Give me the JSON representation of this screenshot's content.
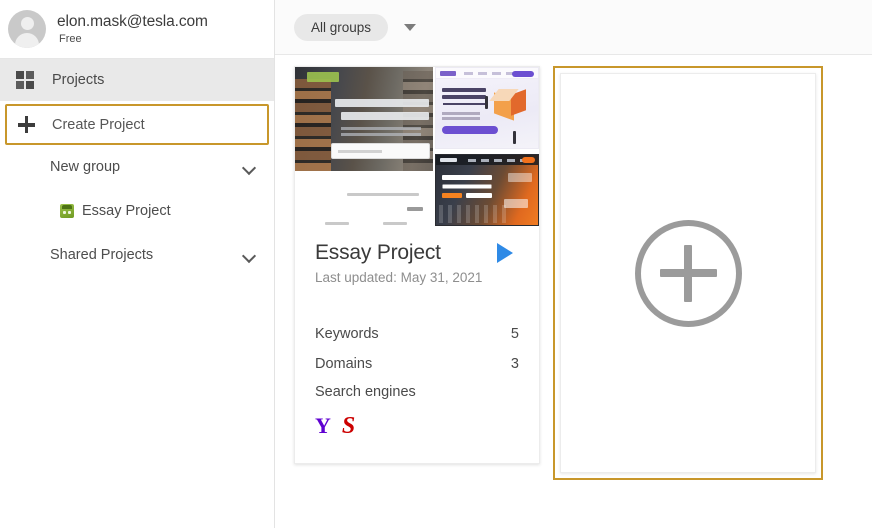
{
  "sidebar": {
    "account": {
      "email": "elon.mask@tesla.com",
      "plan": "Free",
      "avatar_icon": "user-avatar-icon"
    },
    "nav": {
      "projects_label": "Projects",
      "projects_icon": "grid-icon",
      "create_project_label": "Create Project",
      "create_project_icon": "plus-icon"
    },
    "groups": [
      {
        "label": "New group",
        "icon": "chevron-down-icon"
      },
      {
        "label": "Shared Projects",
        "icon": "chevron-down-icon"
      }
    ],
    "projects": [
      {
        "label": "Essay Project",
        "icon": "site-favicon-icon"
      }
    ]
  },
  "topbar": {
    "group_filter_label": "All groups",
    "caret_icon": "caret-down-icon"
  },
  "project_card": {
    "title": "Essay Project",
    "last_updated": "Last updated: May 31, 2021",
    "play_icon": "play-icon",
    "stats": [
      {
        "label": "Keywords",
        "value": "5"
      },
      {
        "label": "Domains",
        "value": "3"
      }
    ],
    "search_engines_label": "Search engines",
    "search_engines": [
      {
        "name": "yahoo-icon",
        "glyph": "Y",
        "color": "#5f01d1"
      },
      {
        "name": "seznam-icon",
        "glyph": "S",
        "color": "#cc0000"
      }
    ],
    "thumbnails": [
      {
        "name": "thumbnail-essay-homepage"
      },
      {
        "name": "thumbnail-seo-tool-page"
      },
      {
        "name": "thumbnail-rank-tracking-page"
      }
    ]
  },
  "new_project_card": {
    "add_icon": "plus-circle-icon"
  },
  "colors": {
    "highlight_border": "#c8972b",
    "active_nav_bg": "#e9e9e9",
    "play_blue": "#2f8ae6",
    "plus_gray": "#9b9b9b"
  }
}
